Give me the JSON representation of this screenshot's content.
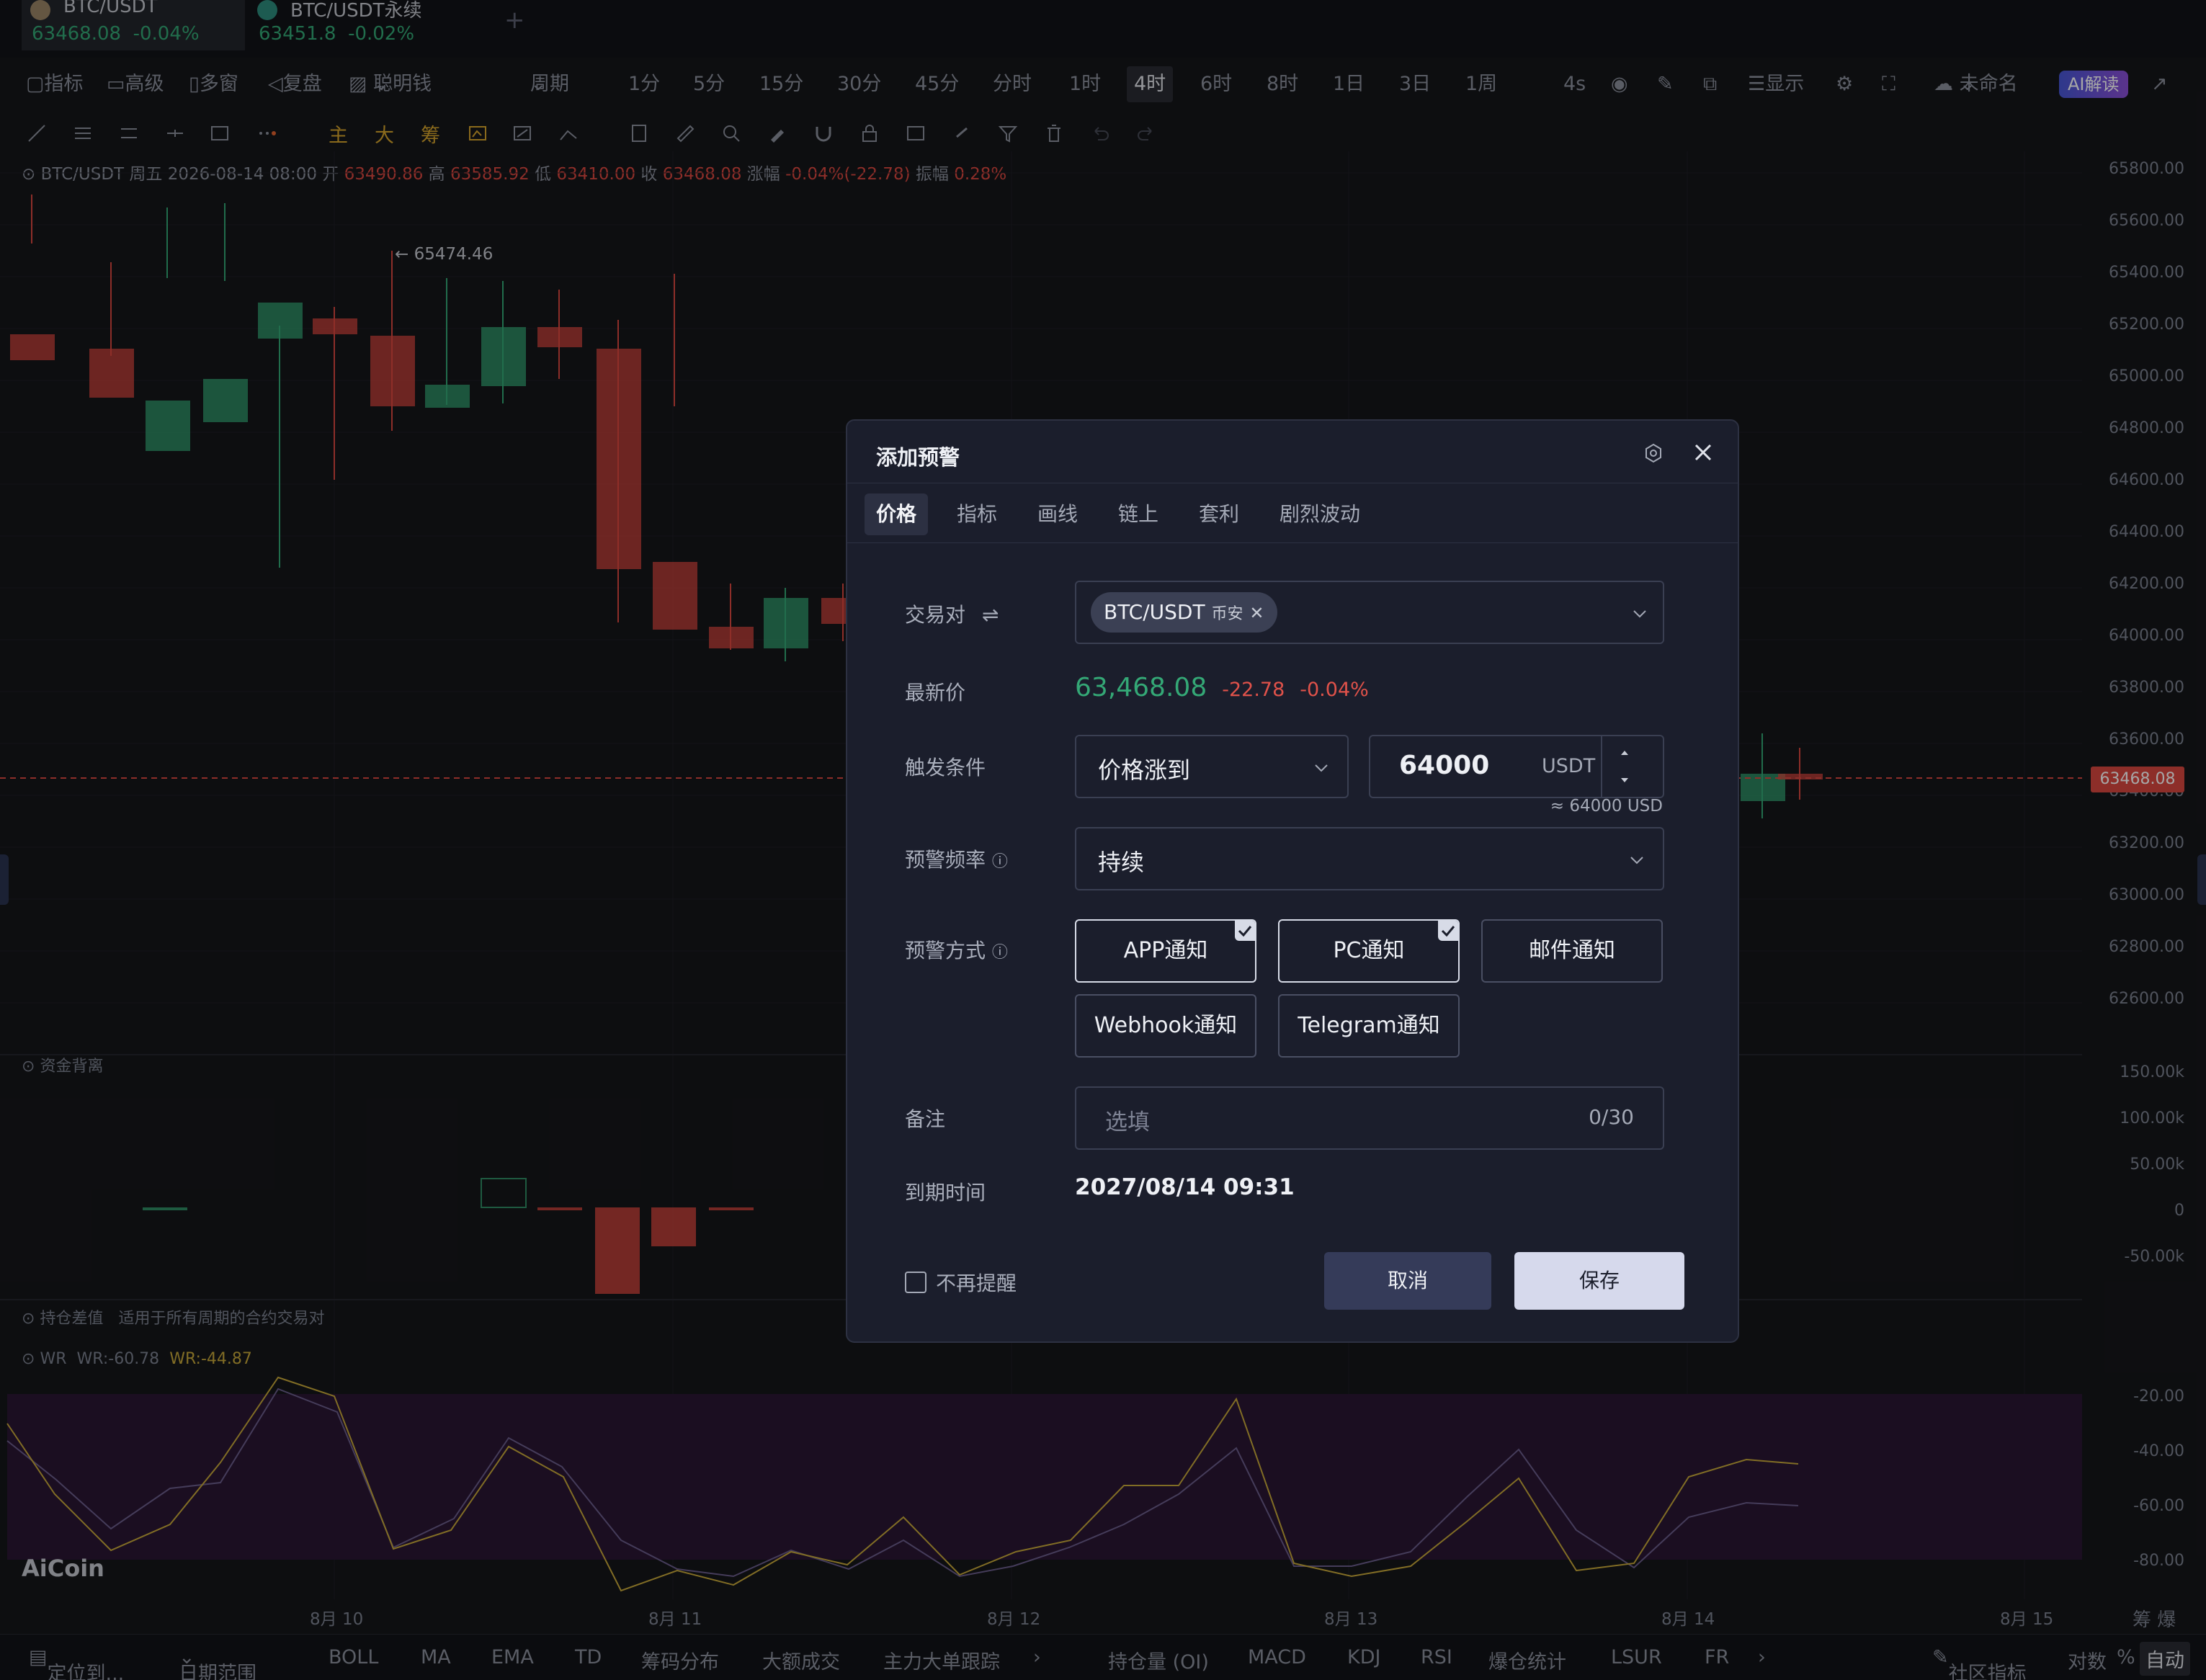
{
  "tabs": [
    {
      "name": "BTC/USDT",
      "price": "63468.08",
      "change": "-0.04%"
    },
    {
      "name": "BTC/USDT永续",
      "price": "63451.8",
      "change": "-0.02%"
    }
  ],
  "toolbar": {
    "indicator": "指标",
    "advanced": "高级",
    "multi": "多窗",
    "replay": "复盘",
    "smart_money": "聪明钱",
    "period": "周期",
    "intervals": [
      "1分",
      "5分",
      "15分",
      "30分",
      "45分",
      "分时",
      "1时",
      "4时",
      "6时",
      "8时",
      "1日",
      "3日",
      "1周"
    ],
    "selected_interval": "4时",
    "countdown": "4s",
    "display": "显示",
    "unnamed": "未命名",
    "ai": "AI解读"
  },
  "toolbar2": {
    "main": "主",
    "big": "大",
    "chip": "筹"
  },
  "info": {
    "symbol": "BTC/USDT",
    "datetime": "周五 2026-08-14 08:00",
    "open_label": "开",
    "open": "63490.86",
    "high_label": "高",
    "high": "63585.92",
    "low_label": "低",
    "low": "63410.00",
    "close_label": "收",
    "close": "63468.08",
    "change_label": "涨幅",
    "change": "-0.04%(-22.78)",
    "amp_label": "振幅",
    "amp": "0.28%"
  },
  "price_axis": [
    "65800.00",
    "65600.00",
    "65400.00",
    "65200.00",
    "65000.00",
    "64800.00",
    "64600.00",
    "64400.00",
    "64200.00",
    "64000.00",
    "63800.00",
    "63600.00",
    "63400.00",
    "63200.00",
    "63000.00",
    "62800.00",
    "62600.00"
  ],
  "current_price_tag": "63468.08",
  "high_marker": "← 65474.46",
  "fund_panel": {
    "label": "资金背离",
    "axis": [
      "150.00k",
      "100.00k",
      "50.00k",
      "0",
      "-50.00k"
    ]
  },
  "oi_panel": {
    "label": "持仓差值",
    "note": "适用于所有周期的合约交易对"
  },
  "wr_panel": {
    "label": "WR",
    "wr1": "WR:-60.78",
    "wr2": "WR:-44.87",
    "axis": [
      "-20.00",
      "-40.00",
      "-60.00",
      "-80.00"
    ]
  },
  "logo": "AiCoin",
  "x_axis": [
    "8月 10",
    "8月 11",
    "8月 12",
    "8月 13",
    "8月 14",
    "8月 15"
  ],
  "x_axis_right": "筹 爆",
  "bottom": {
    "locate": "定位到...",
    "date_range": "日期范围",
    "items": [
      "BOLL",
      "MA",
      "EMA",
      "TD",
      "筹码分布",
      "大额成交",
      "主力大单跟踪",
      "持仓量 (OI)",
      "MACD",
      "KDJ",
      "RSI",
      "爆仓统计",
      "LSUR",
      "FR"
    ],
    "community": "社区指标",
    "log": "对数",
    "pct": "%",
    "auto": "自动"
  },
  "modal": {
    "title": "添加预警",
    "tabs": [
      "价格",
      "指标",
      "画线",
      "链上",
      "套利",
      "剧烈波动"
    ],
    "active_tab": "价格",
    "pair_label": "交易对",
    "pair_value": "BTC/USDT",
    "pair_exchange": "币安",
    "latest_label": "最新价",
    "latest_price": "63,468.08",
    "latest_change": "-22.78",
    "latest_pct": "-0.04%",
    "trigger_label": "触发条件",
    "trigger_value": "价格涨到",
    "target_price": "64000",
    "unit": "USDT",
    "usd_hint": "≈ 64000 USD",
    "freq_label": "预警频率",
    "freq_value": "持续",
    "method_label": "预警方式",
    "methods": [
      {
        "label": "APP通知",
        "checked": true
      },
      {
        "label": "PC通知",
        "checked": true
      },
      {
        "label": "邮件通知",
        "checked": false
      },
      {
        "label": "Webhook通知",
        "checked": false
      },
      {
        "label": "Telegram通知",
        "checked": false
      }
    ],
    "remark_label": "备注",
    "remark_placeholder": "选填",
    "remark_count": "0/30",
    "expire_label": "到期时间",
    "expire_value": "2027/08/14 09:31",
    "dont_remind": "不再提醒",
    "cancel": "取消",
    "save": "保存"
  },
  "colors": {
    "up": "#34a876",
    "down": "#d9473f",
    "wr_band": "#2a1633"
  }
}
